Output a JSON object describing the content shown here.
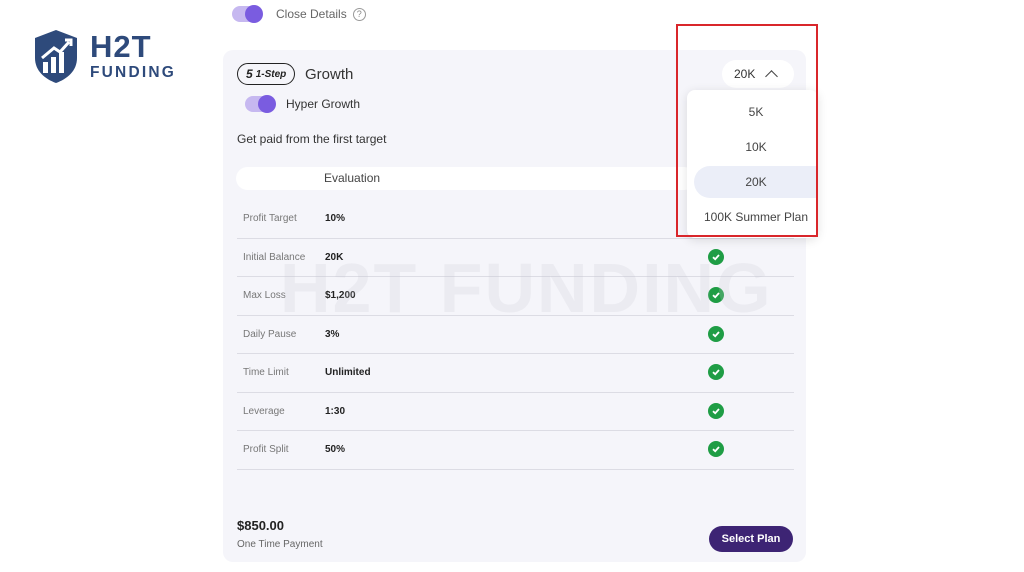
{
  "logo": {
    "h2t": "H2T",
    "funding": "FUNDING"
  },
  "top_row": {
    "label": "Close Details",
    "help_icon": "?",
    "toggle_on": true
  },
  "card": {
    "badge": {
      "number": "5",
      "text": "1-Step"
    },
    "plan_name": "Growth",
    "hyper": {
      "label": "Hyper Growth",
      "toggle_on": true
    },
    "subtitle": "Get paid from the first target",
    "eval_header": "Evaluation",
    "rows": [
      {
        "label": "Profit Target",
        "value": "10%"
      },
      {
        "label": "Initial Balance",
        "value": "20K",
        "check": true
      },
      {
        "label": "Max Loss",
        "value": "$1,200",
        "check": true
      },
      {
        "label": "Daily Pause",
        "value": "3%",
        "check": true
      },
      {
        "label": "Time Limit",
        "value": "Unlimited",
        "check": true
      },
      {
        "label": "Leverage",
        "value": "1:30",
        "check": true
      },
      {
        "label": "Profit Split",
        "value": "50%",
        "check": true
      }
    ],
    "price": "$850.00",
    "price_note": "One Time Payment",
    "select_button": "Select Plan"
  },
  "watermark": "H2T FUNDING",
  "size_selector": {
    "selected": "20K",
    "options": [
      "5K",
      "10K",
      "20K",
      "100K Summer Plan"
    ]
  },
  "colors": {
    "accent": "#7a5ce0",
    "button": "#3d2474",
    "check": "#1f9d45",
    "highlight": "#d9262b",
    "logo": "#2e4a7b"
  }
}
